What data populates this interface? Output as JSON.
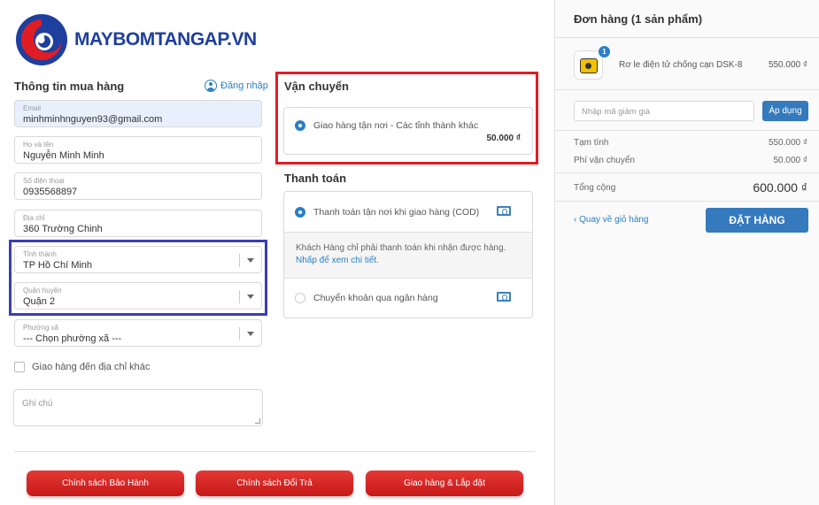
{
  "logo": {
    "text": "MAYBOMTANGAP.VN"
  },
  "customer": {
    "title": "Thông tin mua hàng",
    "login_label": "Đăng nhập",
    "email": {
      "label": "Email",
      "value": "minhminhnguyen93@gmail.com"
    },
    "name": {
      "label": "Họ và tên",
      "value": "Nguyễn Minh Minh"
    },
    "phone": {
      "label": "Số điện thoại",
      "value": "0935568897"
    },
    "address": {
      "label": "Địa chỉ",
      "value": "360 Trường Chinh"
    },
    "province": {
      "label": "Tỉnh thành",
      "value": "TP Hồ Chí Minh"
    },
    "district": {
      "label": "Quận huyện",
      "value": "Quận 2"
    },
    "ward": {
      "label": "Phường xã",
      "value": "--- Chọn phường xã ---"
    },
    "other_address_label": "Giao hàng đến địa chỉ khác",
    "note_placeholder": "Ghi chú"
  },
  "shipping": {
    "title": "Vận chuyển",
    "option_label": "Giao hàng tận nơi - Các tỉnh thành khác",
    "option_price": "50.000 ₫"
  },
  "payment": {
    "title": "Thanh toán",
    "cod_label": "Thanh toán tận nơi khi giao hàng (COD)",
    "cod_info": "Khách Hàng chỉ phải thanh toán khi nhận được hàng.",
    "cod_link": "Nhấp để xem chi tiết.",
    "bank_label": "Chuyển khoản qua ngân hàng"
  },
  "footer": {
    "buttons": [
      "Chính sách Bảo Hành",
      "Chính sách Đổi Trả",
      "Giao hàng & Lắp đặt"
    ]
  },
  "order": {
    "title": "Đơn hàng (1 sản phẩm)",
    "item": {
      "qty": "1",
      "name": "Rơ le điện tử chống cạn DSK-8",
      "price": "550.000 ₫"
    },
    "coupon_placeholder": "Nhập mã giảm giá",
    "apply_label": "Áp dụng",
    "subtotal_label": "Tạm tính",
    "subtotal_value": "550.000 ₫",
    "shipping_fee_label": "Phí vận chuyển",
    "shipping_fee_value": "50.000 ₫",
    "total_label": "Tổng cộng",
    "total_value": "600.000 ₫",
    "back_label": "Quay về giỏ hàng",
    "place_order_label": "ĐẶT HÀNG"
  },
  "colors": {
    "accent_blue": "#2a7fc4",
    "button_red": "#d32020",
    "frame_red": "#e01d24",
    "frame_blue": "#3a3db3"
  },
  "icons": [
    "logo-swirl-icon",
    "user-icon",
    "chevron-down-icon",
    "money-icon",
    "product-thumbnail"
  ]
}
